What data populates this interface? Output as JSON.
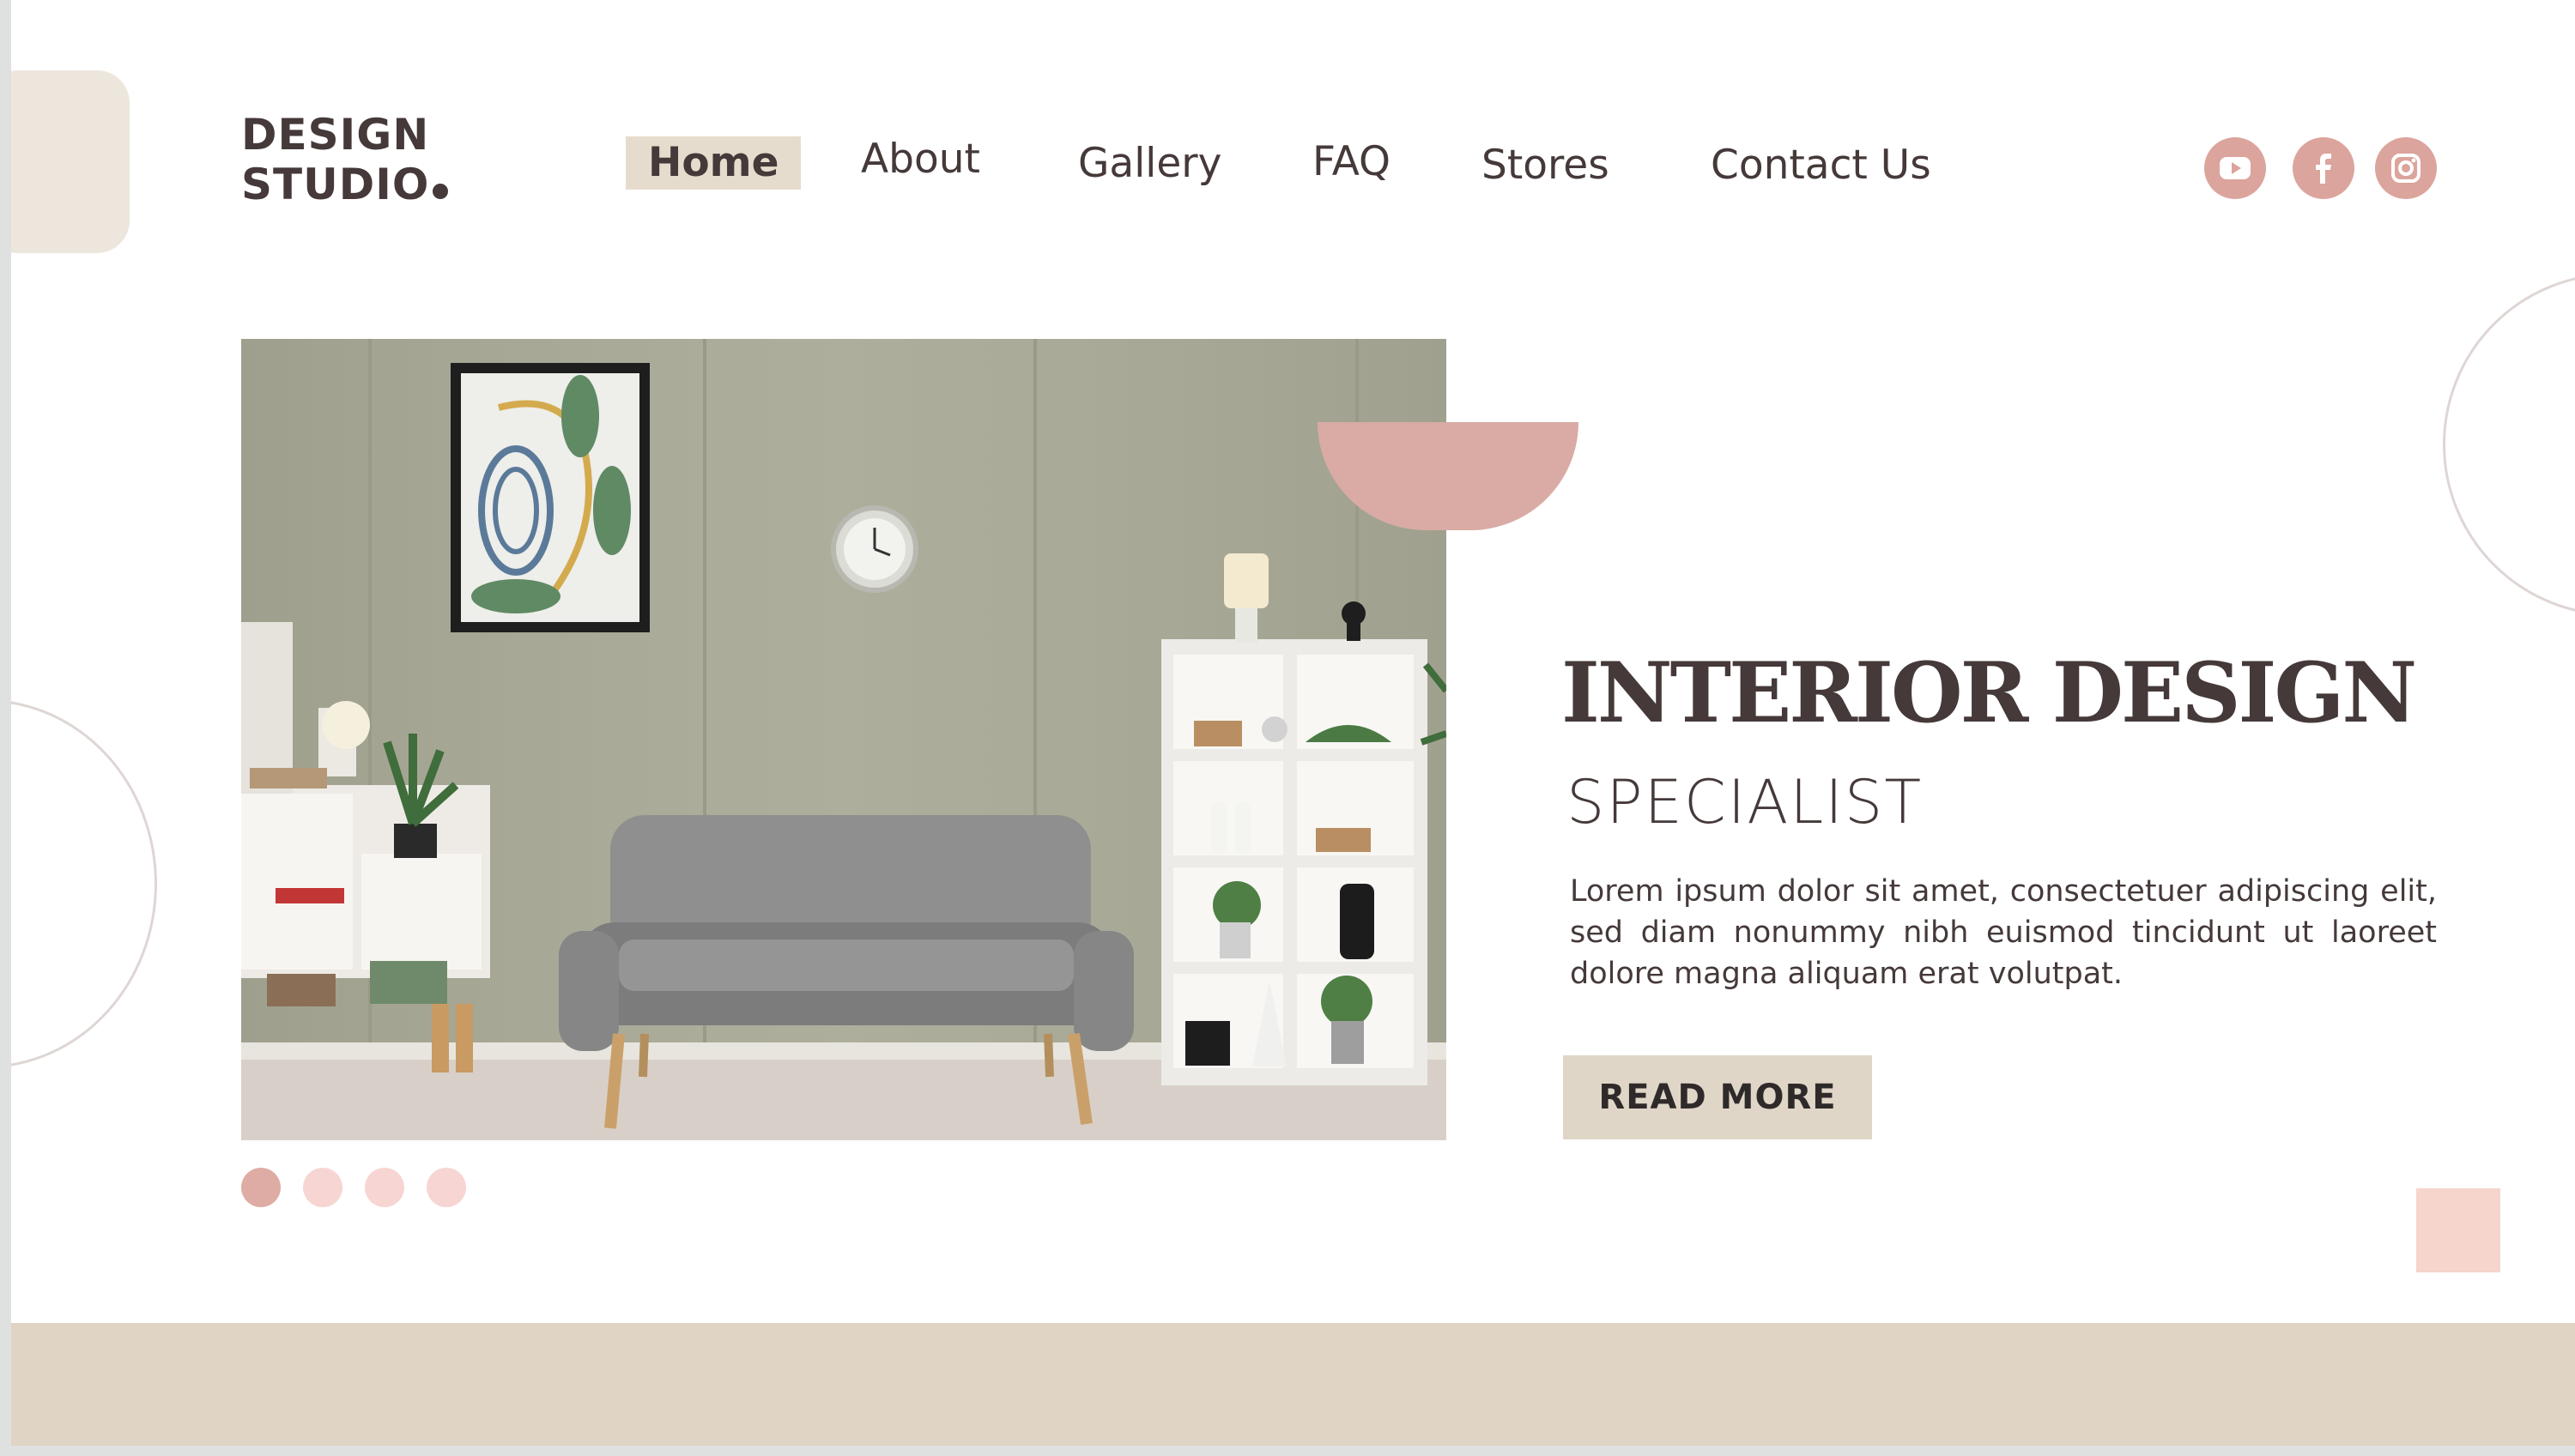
{
  "brand": {
    "line1": "DESIGN",
    "line2": "STUDIO"
  },
  "nav": {
    "home": "Home",
    "about": "About",
    "gallery": "Gallery",
    "faq": "FAQ",
    "stores": "Stores",
    "contact": "Contact Us"
  },
  "social": [
    "youtube-icon",
    "facebook-icon",
    "instagram-icon"
  ],
  "hero": {
    "title": "INTERIOR DESIGN",
    "subtitle": "SPECIALIST",
    "body": "Lorem ipsum dolor sit amet, consectetuer adipiscing elit, sed diam nonummy nibh euismod tincidunt ut laoreet dolore magna aliquam erat volutpat.",
    "cta": "READ MORE"
  },
  "slider": {
    "count": 4,
    "active": 1
  },
  "colors": {
    "text": "#453939",
    "accent_pink": "#d9aba4",
    "accent_beige": "#e0d4c4",
    "light_pink": "#f5d5cc"
  }
}
